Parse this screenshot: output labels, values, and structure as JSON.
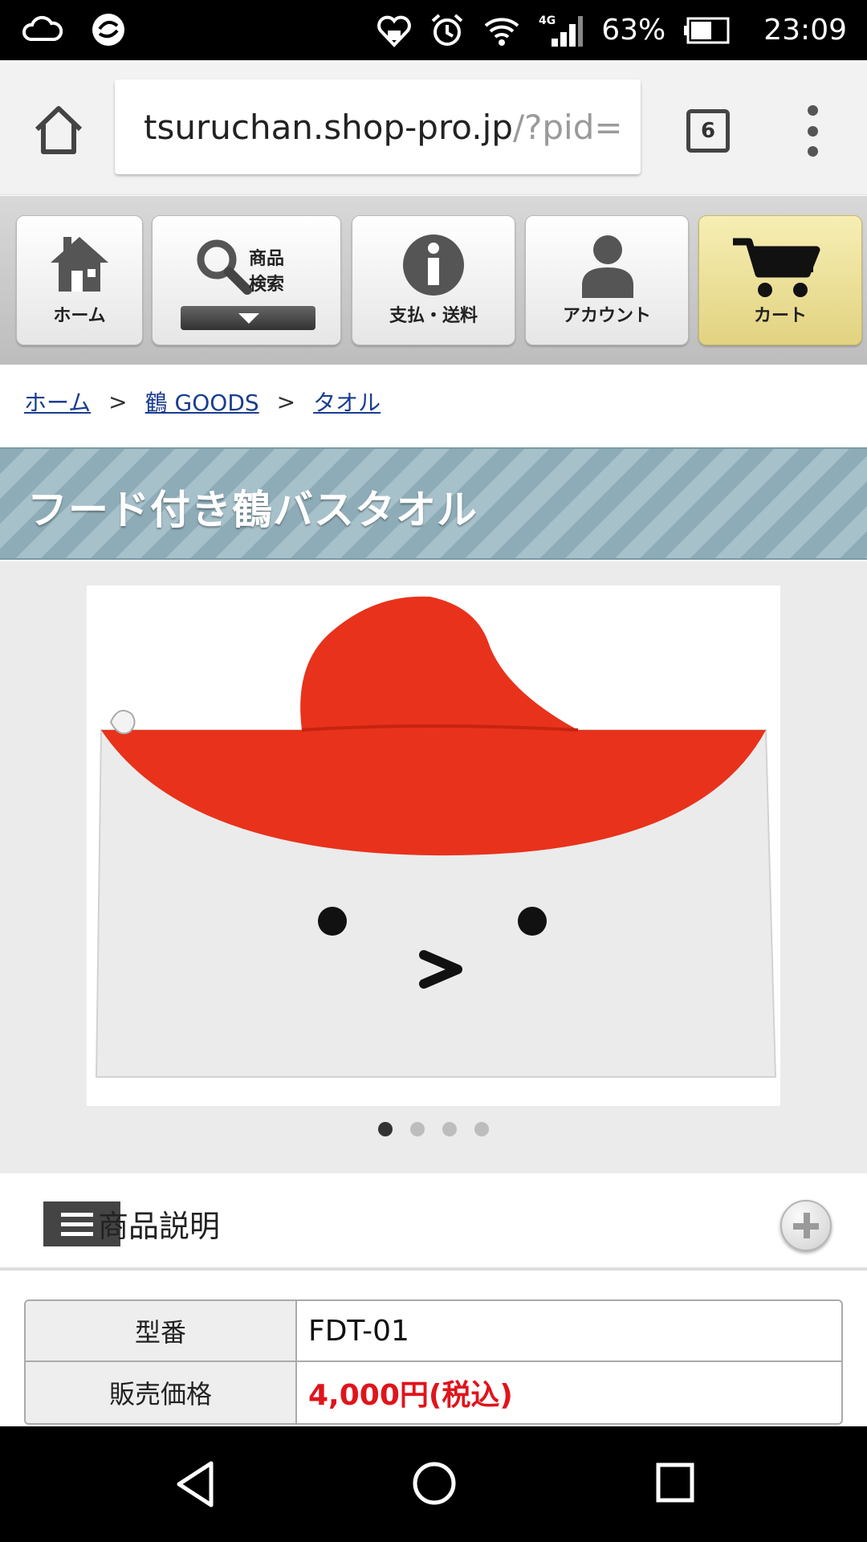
{
  "status_bar": {
    "battery": "63%",
    "time": "23:09",
    "network": "4G"
  },
  "browser": {
    "url_host": "tsuruchan.shop-pro.jp",
    "url_path": "/?pid=",
    "tab_count": "6"
  },
  "nav": {
    "home": "ホーム",
    "search_line1": "商品",
    "search_line2": "検索",
    "payment": "支払・送料",
    "account": "アカウント",
    "cart": "カート"
  },
  "breadcrumb": {
    "items": [
      "ホーム",
      "鶴 GOODS",
      "タオル"
    ],
    "separator": ">"
  },
  "product": {
    "title": "フード付き鶴バスタオル",
    "image_count": 4,
    "active_image": 1
  },
  "description": {
    "heading": "商品説明"
  },
  "spec": {
    "rows": [
      {
        "key": "型番",
        "value": "FDT-01"
      },
      {
        "key": "販売価格",
        "value": "4,000円(税込)"
      }
    ]
  },
  "colors": {
    "price": "#e0141c",
    "towel_red": "#e8321c",
    "banner": "#9ab6c1",
    "cart_button": "#e9dc93"
  }
}
